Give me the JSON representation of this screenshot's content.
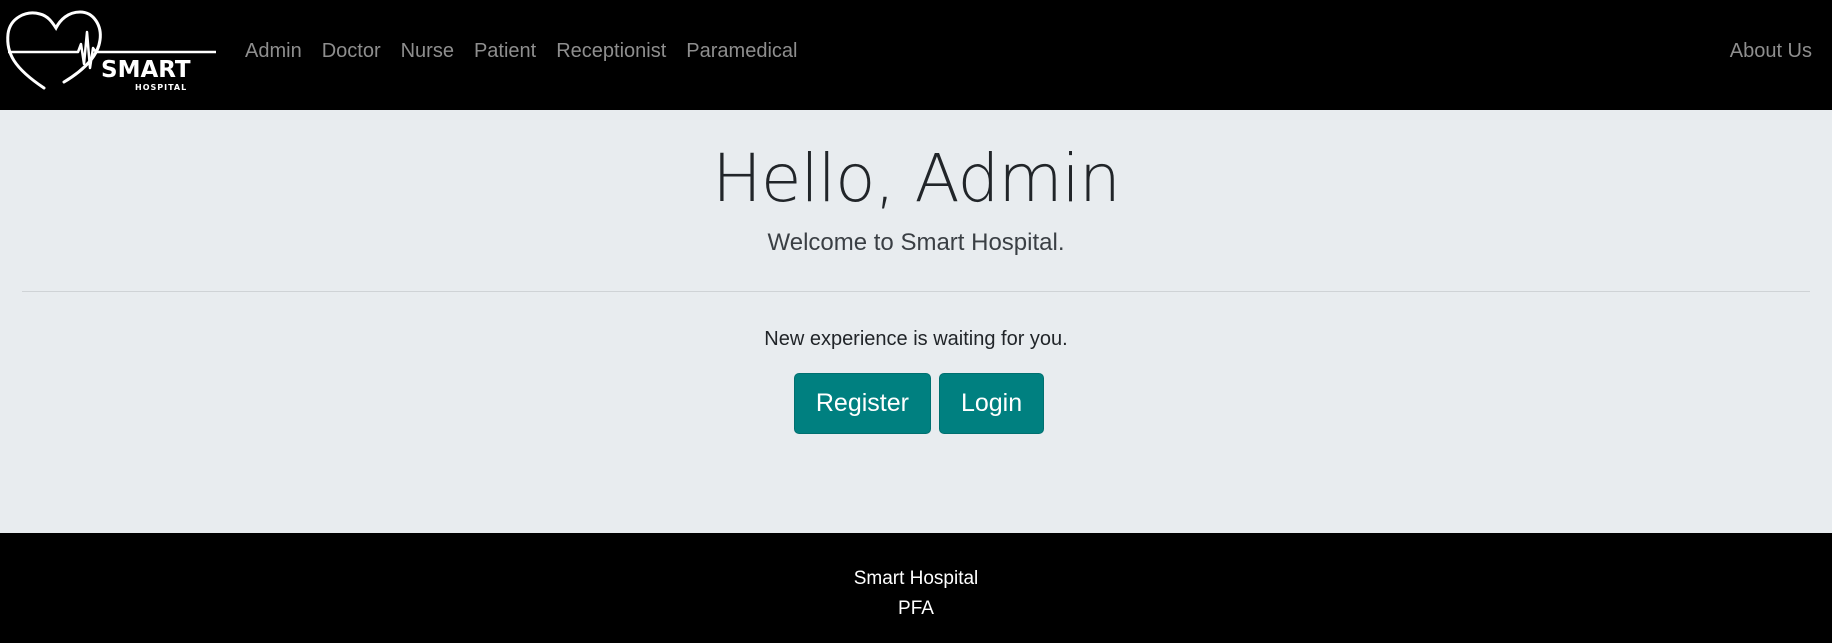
{
  "brand": {
    "logo_word": "SMART",
    "logo_sub": "HOSPITAL"
  },
  "nav": {
    "items": [
      {
        "label": "Admin"
      },
      {
        "label": "Doctor"
      },
      {
        "label": "Nurse"
      },
      {
        "label": "Patient"
      },
      {
        "label": "Receptionist"
      },
      {
        "label": "Paramedical"
      }
    ],
    "right_label": "About Us"
  },
  "hero": {
    "title": "Hello, Admin",
    "lead": "Welcome to Smart Hospital.",
    "text": "New experience is waiting for you.",
    "register_label": "Register",
    "login_label": "Login"
  },
  "footer": {
    "line1": "Smart Hospital",
    "line2": "PFA"
  },
  "colors": {
    "accent": "#008080",
    "navbar_bg": "#000000",
    "jumbotron_bg": "#e8ecef",
    "nav_link": "#8e8e8e"
  }
}
